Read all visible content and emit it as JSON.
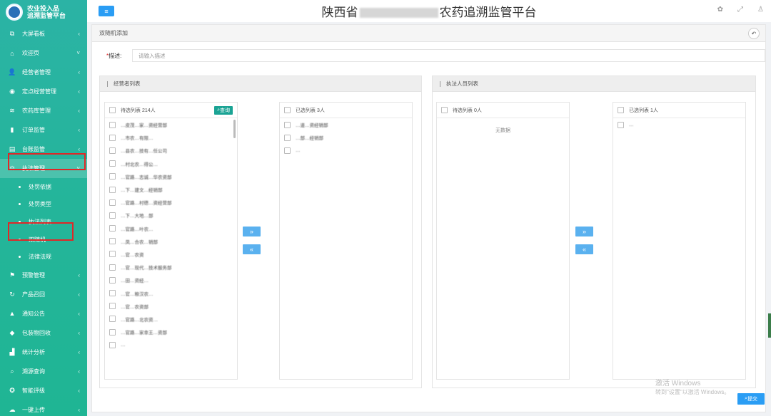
{
  "app": {
    "logo_line1": "农业投入品",
    "logo_line2": "追溯监管平台",
    "title_prefix": "陕西省",
    "title_suffix": "农药追溯监管平台"
  },
  "sidebar": {
    "items": [
      {
        "label": "大屏看板",
        "icon": "dashboard-icon",
        "glyph": "⧉",
        "chev": "‹"
      },
      {
        "label": "欢迎页",
        "icon": "home-icon",
        "glyph": "⌂",
        "chev": "˅"
      },
      {
        "label": "经营者管理",
        "icon": "user-icon",
        "glyph": "👤",
        "chev": "‹"
      },
      {
        "label": "定点经营管理",
        "icon": "location-icon",
        "glyph": "◉",
        "chev": "‹"
      },
      {
        "label": "农药库管理",
        "icon": "stack-icon",
        "glyph": "≋",
        "chev": "‹"
      },
      {
        "label": "订单监管",
        "icon": "bar-chart-icon",
        "glyph": "▮",
        "chev": "‹"
      },
      {
        "label": "台账监管",
        "icon": "ledger-icon",
        "glyph": "▤",
        "chev": "‹"
      },
      {
        "label": "执法管理",
        "icon": "law-icon",
        "glyph": "⚖",
        "chev": "˅"
      },
      {
        "label": "预警管理",
        "icon": "alarm-icon",
        "glyph": "⚑",
        "chev": "‹"
      },
      {
        "label": "产品召回",
        "icon": "refresh-icon",
        "glyph": "↻",
        "chev": "‹"
      },
      {
        "label": "通知公告",
        "icon": "warning-icon",
        "glyph": "▲",
        "chev": "‹"
      },
      {
        "label": "包装物回收",
        "icon": "box-icon",
        "glyph": "◆",
        "chev": "‹"
      },
      {
        "label": "统计分析",
        "icon": "stats-icon",
        "glyph": "▟",
        "chev": "‹"
      },
      {
        "label": "溯源查询",
        "icon": "search-icon",
        "glyph": "⌕",
        "chev": "‹"
      },
      {
        "label": "智能评级",
        "icon": "medal-icon",
        "glyph": "✪",
        "chev": "‹"
      },
      {
        "label": "一键上传",
        "icon": "cloud-upload-icon",
        "glyph": "☁",
        "chev": "‹"
      }
    ],
    "sub_items": [
      "处罚依据",
      "处罚类型",
      "执法列表",
      "双随机",
      "法律法规"
    ]
  },
  "page": {
    "breadcrumb": "双随机添加",
    "desc_label": "描述:",
    "desc_required": "*",
    "desc_placeholder": "请输入描述"
  },
  "operators": {
    "panel_title": "经营者列表",
    "pending_title": "待选列表 214人",
    "query_label": "查询",
    "selected_title": "已选列表 3人",
    "pending_rows": [
      "…皮茂…家…资经营部",
      "…市农…有限…",
      "…县农…技有…任公司",
      "…村北农…得公…",
      "…官路…志诚…华农资部",
      "…下…建文…经销部",
      "…官路…村德…资经营部",
      "…下…大地…部",
      "…官路…叶农…",
      "…凤…合农…销部",
      "…官…农资",
      "…官…现代…技术服务部",
      "…田…资经…",
      "…官…粮汉农…",
      "…官…农资部",
      "…官路…北农资…",
      "…官路…家幸王…资部",
      "…"
    ],
    "selected_rows": [
      "…道…资经销部",
      "…部…经销部",
      "…"
    ]
  },
  "enforcers": {
    "panel_title": "执法人员列表",
    "pending_title": "待选列表 0人",
    "empty_text": "无数据",
    "selected_title": "已选列表 1人",
    "selected_rows": [
      "…"
    ]
  },
  "transfer": {
    "right": "»",
    "left": "«"
  },
  "watermark": {
    "line1": "激活 Windows",
    "line2": "转到\"设置\"以激活 Windows。"
  },
  "submit_label": "提交",
  "colors": {
    "sidebar": "#24b59a",
    "primary": "#2a9df4",
    "highlight": "#e02727",
    "query": "#1aa394",
    "transfer": "#5ab1ef"
  }
}
